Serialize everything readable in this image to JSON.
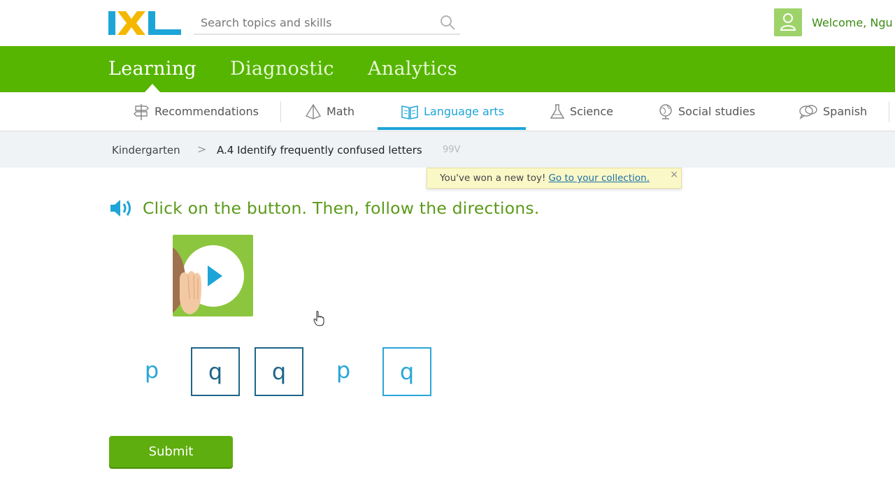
{
  "brand": {
    "logo_text": "IXL",
    "colors": {
      "green": "#56b500",
      "blue": "#1ea5d8",
      "yellow": "#f5b800"
    }
  },
  "header": {
    "search_placeholder": "Search topics and skills",
    "welcome": "Welcome, Ngu"
  },
  "mainnav": {
    "tabs": [
      {
        "label": "Learning"
      },
      {
        "label": "Diagnostic"
      },
      {
        "label": "Analytics"
      }
    ],
    "active": "Learning"
  },
  "subnav": {
    "items": [
      {
        "label": "Recommendations",
        "icon": "signpost-icon"
      },
      {
        "label": "Math",
        "icon": "pyramid-icon"
      },
      {
        "label": "Language arts",
        "icon": "book-icon"
      },
      {
        "label": "Science",
        "icon": "flask-icon"
      },
      {
        "label": "Social studies",
        "icon": "globe-icon"
      },
      {
        "label": "Spanish",
        "icon": "speech-bubbles-icon"
      }
    ],
    "active": "Language arts"
  },
  "breadcrumb": {
    "grade": "Kindergarten",
    "separator": ">",
    "skill": "A.4 Identify frequently confused letters",
    "code": "99V"
  },
  "toast": {
    "text": "You've won a new toy!",
    "link": "Go to your collection.",
    "close": "×"
  },
  "question": {
    "prompt": "Click on the button. Then, follow the directions.",
    "letters": [
      "p",
      "q",
      "q",
      "p",
      "q"
    ]
  },
  "submit_label": "Submit"
}
